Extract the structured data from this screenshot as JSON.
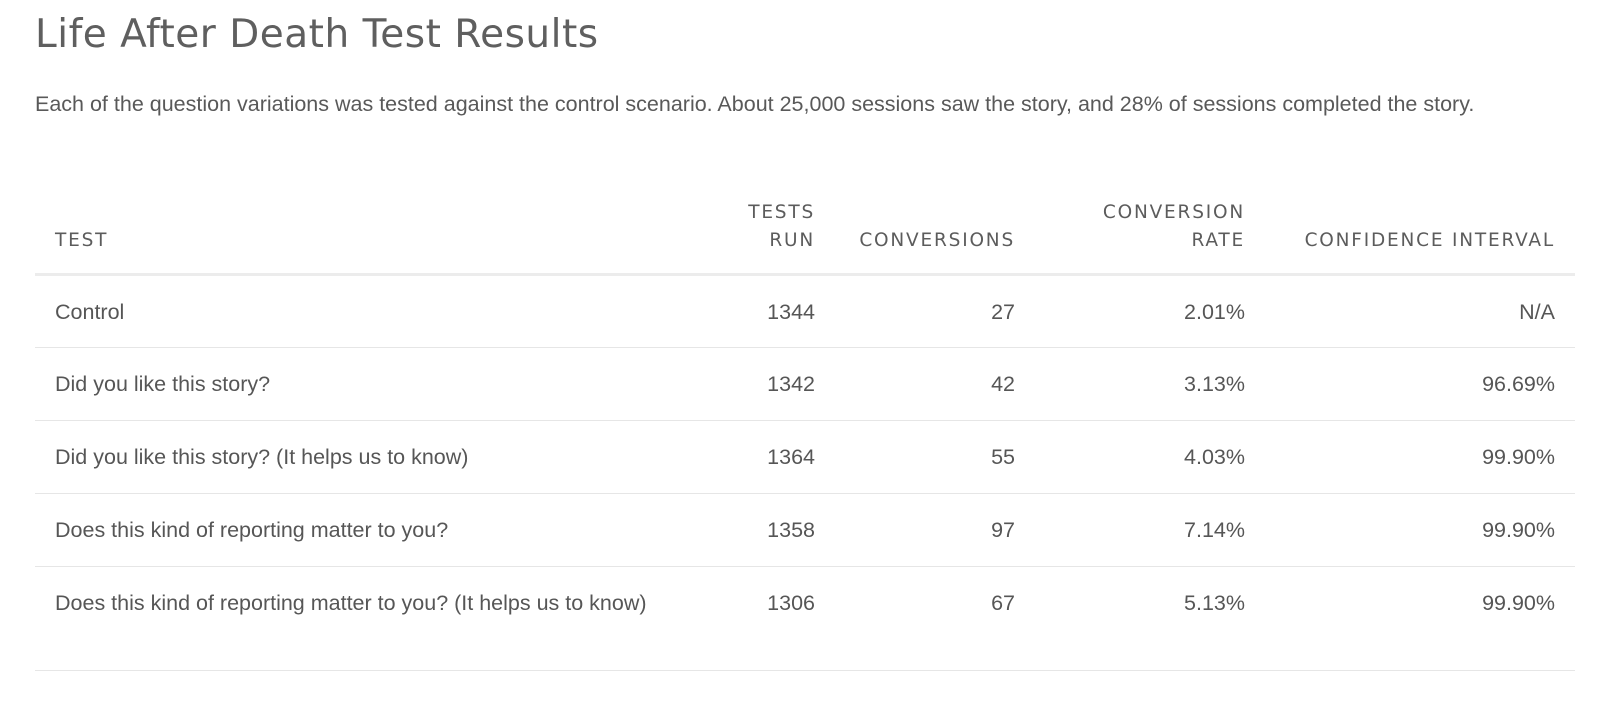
{
  "page": {
    "title": "Life After Death Test Results",
    "intro": "Each of the question variations was tested against the control scenario. About 25,000 sessions saw the story, and 28% of sessions completed the story."
  },
  "table": {
    "headers": {
      "test": "TEST",
      "tests_run": "TESTS RUN",
      "conversions": "CONVERSIONS",
      "conversion_rate": "CONVERSION RATE",
      "confidence_interval": "CONFIDENCE INTERVAL"
    },
    "rows": [
      {
        "test": "Control",
        "tests_run": "1344",
        "conversions": "27",
        "conversion_rate": "2.01%",
        "confidence_interval": "N/A"
      },
      {
        "test": "Did you like this story?",
        "tests_run": "1342",
        "conversions": "42",
        "conversion_rate": "3.13%",
        "confidence_interval": "96.69%"
      },
      {
        "test": "Did you like this story? (It helps us to know)",
        "tests_run": "1364",
        "conversions": "55",
        "conversion_rate": "4.03%",
        "confidence_interval": "99.90%"
      },
      {
        "test": "Does this kind of reporting matter to you?",
        "tests_run": "1358",
        "conversions": "97",
        "conversion_rate": "7.14%",
        "confidence_interval": "99.90%"
      },
      {
        "test": "Does this kind of reporting matter to you? (It helps us to know)",
        "tests_run": "1306",
        "conversions": "67",
        "conversion_rate": "5.13%",
        "confidence_interval": "99.90%"
      }
    ]
  }
}
